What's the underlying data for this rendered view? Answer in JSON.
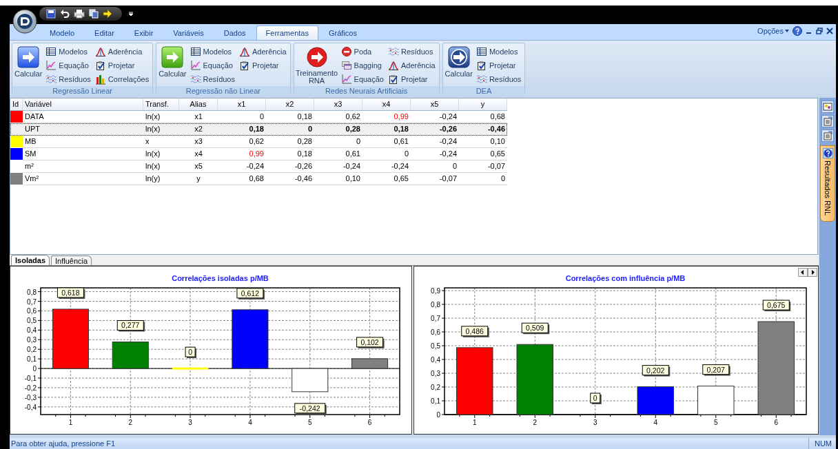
{
  "ribbon": {
    "tabs": [
      {
        "label": "Modelo",
        "selected": false
      },
      {
        "label": "Editar",
        "selected": false
      },
      {
        "label": "Exibir",
        "selected": false
      },
      {
        "label": "Variáveis",
        "selected": false
      },
      {
        "label": "Dados",
        "selected": false
      },
      {
        "label": "Ferramentas",
        "selected": true
      },
      {
        "label": "Gráficos",
        "selected": false
      }
    ],
    "options_menu": "Opções",
    "groups": [
      {
        "title": "Regressão Linear",
        "main": {
          "label": "Calcular",
          "kind": "arrow-blue"
        },
        "items": [
          {
            "label": "Modelos",
            "kind": "table"
          },
          {
            "label": "Equação",
            "kind": "equation"
          },
          {
            "label": "Resíduos",
            "kind": "residuals"
          },
          {
            "label": "Aderência",
            "kind": "fit"
          },
          {
            "label": "Projetar",
            "kind": "project"
          },
          {
            "label": "Correlações",
            "kind": "bars"
          }
        ]
      },
      {
        "title": "Regressão não Linear",
        "main": {
          "label": "Calcular",
          "kind": "arrow-green"
        },
        "items": [
          {
            "label": "Modelos",
            "kind": "table"
          },
          {
            "label": "Equação",
            "kind": "equation"
          },
          {
            "label": "Resíduos",
            "kind": "residuals"
          },
          {
            "label": "Aderência",
            "kind": "fit"
          },
          {
            "label": "Projetar",
            "kind": "project"
          }
        ]
      },
      {
        "title": "Redes Neurais Artificiais",
        "main": {
          "label": "Treinamento RNA",
          "kind": "arrow-red"
        },
        "items": [
          {
            "label": "Poda",
            "kind": "prune"
          },
          {
            "label": "Bagging",
            "kind": "bagging"
          },
          {
            "label": "Equação",
            "kind": "equation"
          },
          {
            "label": "Resíduos",
            "kind": "residuals"
          },
          {
            "label": "Aderência",
            "kind": "fit"
          },
          {
            "label": "Projetar",
            "kind": "project"
          }
        ]
      },
      {
        "title": "DEA",
        "main": {
          "label": "Calcular",
          "kind": "arrow-navy"
        },
        "items": [
          {
            "label": "Modelos",
            "kind": "table"
          },
          {
            "label": "Projetar",
            "kind": "project"
          },
          {
            "label": "Resíduos",
            "kind": "residuals"
          }
        ]
      }
    ]
  },
  "grid": {
    "columns": [
      "Id",
      "Variável",
      "Transf.",
      "Alias",
      "x1",
      "x2",
      "x3",
      "x4",
      "x5",
      "y"
    ],
    "rows": [
      {
        "color": "#ff0000",
        "name": "DATA",
        "transform": "ln(x)",
        "alias": "x1",
        "selected": false,
        "values": [
          {
            "text": "0",
            "flagged": false
          },
          {
            "text": "0,18",
            "flagged": false
          },
          {
            "text": "0,62",
            "flagged": false
          },
          {
            "text": "0,99",
            "flagged": true
          },
          {
            "text": "-0,24",
            "flagged": false
          },
          {
            "text": "0,68",
            "flagged": false
          }
        ]
      },
      {
        "name": "UPT",
        "transform": "ln(x)",
        "alias": "x2",
        "selected": true,
        "values": [
          {
            "text": "0,18",
            "flagged": false
          },
          {
            "text": "0",
            "flagged": false
          },
          {
            "text": "0,28",
            "flagged": false
          },
          {
            "text": "0,18",
            "flagged": false
          },
          {
            "text": "-0,26",
            "flagged": false
          },
          {
            "text": "-0,46",
            "flagged": false
          }
        ]
      },
      {
        "color": "#ffff00",
        "name": "MB",
        "transform": "x",
        "alias": "x3",
        "selected": false,
        "values": [
          {
            "text": "0,62",
            "flagged": false
          },
          {
            "text": "0,28",
            "flagged": false
          },
          {
            "text": "0",
            "flagged": false
          },
          {
            "text": "0,61",
            "flagged": false
          },
          {
            "text": "-0,24",
            "flagged": false
          },
          {
            "text": "0,10",
            "flagged": false
          }
        ]
      },
      {
        "color": "#0000ff",
        "name": "SM",
        "transform": "ln(x)",
        "alias": "x4",
        "selected": false,
        "values": [
          {
            "text": "0,99",
            "flagged": true
          },
          {
            "text": "0,18",
            "flagged": false
          },
          {
            "text": "0,61",
            "flagged": false
          },
          {
            "text": "0",
            "flagged": false
          },
          {
            "text": "-0,24",
            "flagged": false
          },
          {
            "text": "0,65",
            "flagged": false
          }
        ]
      },
      {
        "name": "m²",
        "transform": "ln(x)",
        "alias": "x5",
        "selected": false,
        "values": [
          {
            "text": "-0,24",
            "flagged": false
          },
          {
            "text": "-0,26",
            "flagged": false
          },
          {
            "text": "-0,24",
            "flagged": false
          },
          {
            "text": "-0,24",
            "flagged": false
          },
          {
            "text": "0",
            "flagged": false
          },
          {
            "text": "-0,07",
            "flagged": false
          }
        ]
      },
      {
        "color": "#808080",
        "name": "Vm²",
        "transform": "ln(y)",
        "alias": "y",
        "selected": false,
        "values": [
          {
            "text": "0,68",
            "flagged": false
          },
          {
            "text": "-0,46",
            "flagged": false
          },
          {
            "text": "0,10",
            "flagged": false
          },
          {
            "text": "0,65",
            "flagged": false
          },
          {
            "text": "-0,07",
            "flagged": false
          },
          {
            "text": "0",
            "flagged": false
          }
        ]
      }
    ]
  },
  "chart_tabs": [
    {
      "label": "Isoladas",
      "selected": true
    },
    {
      "label": "Influência",
      "selected": false
    }
  ],
  "charts": [
    {
      "chart_data": {
        "type": "bar",
        "title": "Correlações isoladas p/MB",
        "categories": [
          "1",
          "2",
          "3",
          "4",
          "5",
          "6"
        ],
        "grid": true,
        "stacked": true,
        "series": [
          {
            "color": "#ff0000",
            "values": [
              0.618,
              null,
              null,
              null,
              null,
              null
            ]
          },
          {
            "color": "#008000",
            "values": [
              null,
              0.277,
              null,
              null,
              null,
              null
            ]
          },
          {
            "color": "#ffff00",
            "values": [
              null,
              null,
              0,
              null,
              null,
              null
            ]
          },
          {
            "color": "#0000ff",
            "values": [
              null,
              null,
              null,
              0.612,
              null,
              null
            ]
          },
          {
            "color": "#ffffff",
            "values": [
              null,
              null,
              null,
              null,
              -0.242,
              null
            ]
          },
          {
            "color": "#808080",
            "values": [
              null,
              null,
              null,
              null,
              null,
              0.102
            ]
          }
        ],
        "ylim": [
          -0.48,
          0.84
        ],
        "yticks": [
          {
            "value": -0.4,
            "label": "-0,4"
          },
          {
            "value": -0.3,
            "label": "-0,3"
          },
          {
            "value": -0.2,
            "label": "-0,2"
          },
          {
            "value": -0.1,
            "label": "-0,1"
          },
          {
            "value": 0,
            "label": "0"
          },
          {
            "value": 0.1,
            "label": "0,1"
          },
          {
            "value": 0.2,
            "label": "0,2"
          },
          {
            "value": 0.3,
            "label": "0,3"
          },
          {
            "value": 0.4,
            "label": "0,4"
          },
          {
            "value": 0.5,
            "label": "0,5"
          },
          {
            "value": 0.6,
            "label": "0,6"
          },
          {
            "value": 0.7,
            "label": "0,7"
          },
          {
            "value": 0.8,
            "label": "0,8"
          }
        ],
        "value_labels": [
          "0,618",
          "0,277",
          "0",
          "0,612",
          "-0,242",
          "0,102"
        ]
      }
    },
    {
      "chart_data": {
        "type": "bar",
        "title": "Correlações com influência p/MB",
        "categories": [
          "1",
          "2",
          "3",
          "4",
          "5",
          "6"
        ],
        "grid": true,
        "stacked": true,
        "series": [
          {
            "color": "#ff0000",
            "values": [
              0.486,
              null,
              null,
              null,
              null,
              null
            ]
          },
          {
            "color": "#008000",
            "values": [
              null,
              0.509,
              null,
              null,
              null,
              null
            ]
          },
          {
            "values": [
              null,
              null,
              0,
              null,
              null,
              null
            ]
          },
          {
            "color": "#0000ff",
            "values": [
              null,
              null,
              null,
              0.202,
              null,
              null
            ]
          },
          {
            "color": "#ffffff",
            "values": [
              null,
              null,
              null,
              null,
              0.207,
              null
            ]
          },
          {
            "color": "#808080",
            "values": [
              null,
              null,
              null,
              null,
              null,
              0.675
            ]
          }
        ],
        "ylim": [
          0,
          0.92
        ],
        "yticks": [
          {
            "value": 0,
            "label": "0"
          },
          {
            "value": 0.1,
            "label": "0,1"
          },
          {
            "value": 0.2,
            "label": "0,2"
          },
          {
            "value": 0.3,
            "label": "0,3"
          },
          {
            "value": 0.4,
            "label": "0,4"
          },
          {
            "value": 0.5,
            "label": "0,5"
          },
          {
            "value": 0.6,
            "label": "0,6"
          },
          {
            "value": 0.7,
            "label": "0,7"
          },
          {
            "value": 0.8,
            "label": "0,8"
          },
          {
            "value": 0.9,
            "label": "0,9"
          }
        ],
        "value_labels": [
          "0,486",
          "0,509",
          "0",
          "0,202",
          "0,207",
          "0,675"
        ]
      }
    }
  ],
  "side_dock": {
    "tab": "Resultados RNL"
  },
  "status_bar": {
    "message": "Para obter ajuda, pressione F1",
    "indicator": "NUM"
  }
}
